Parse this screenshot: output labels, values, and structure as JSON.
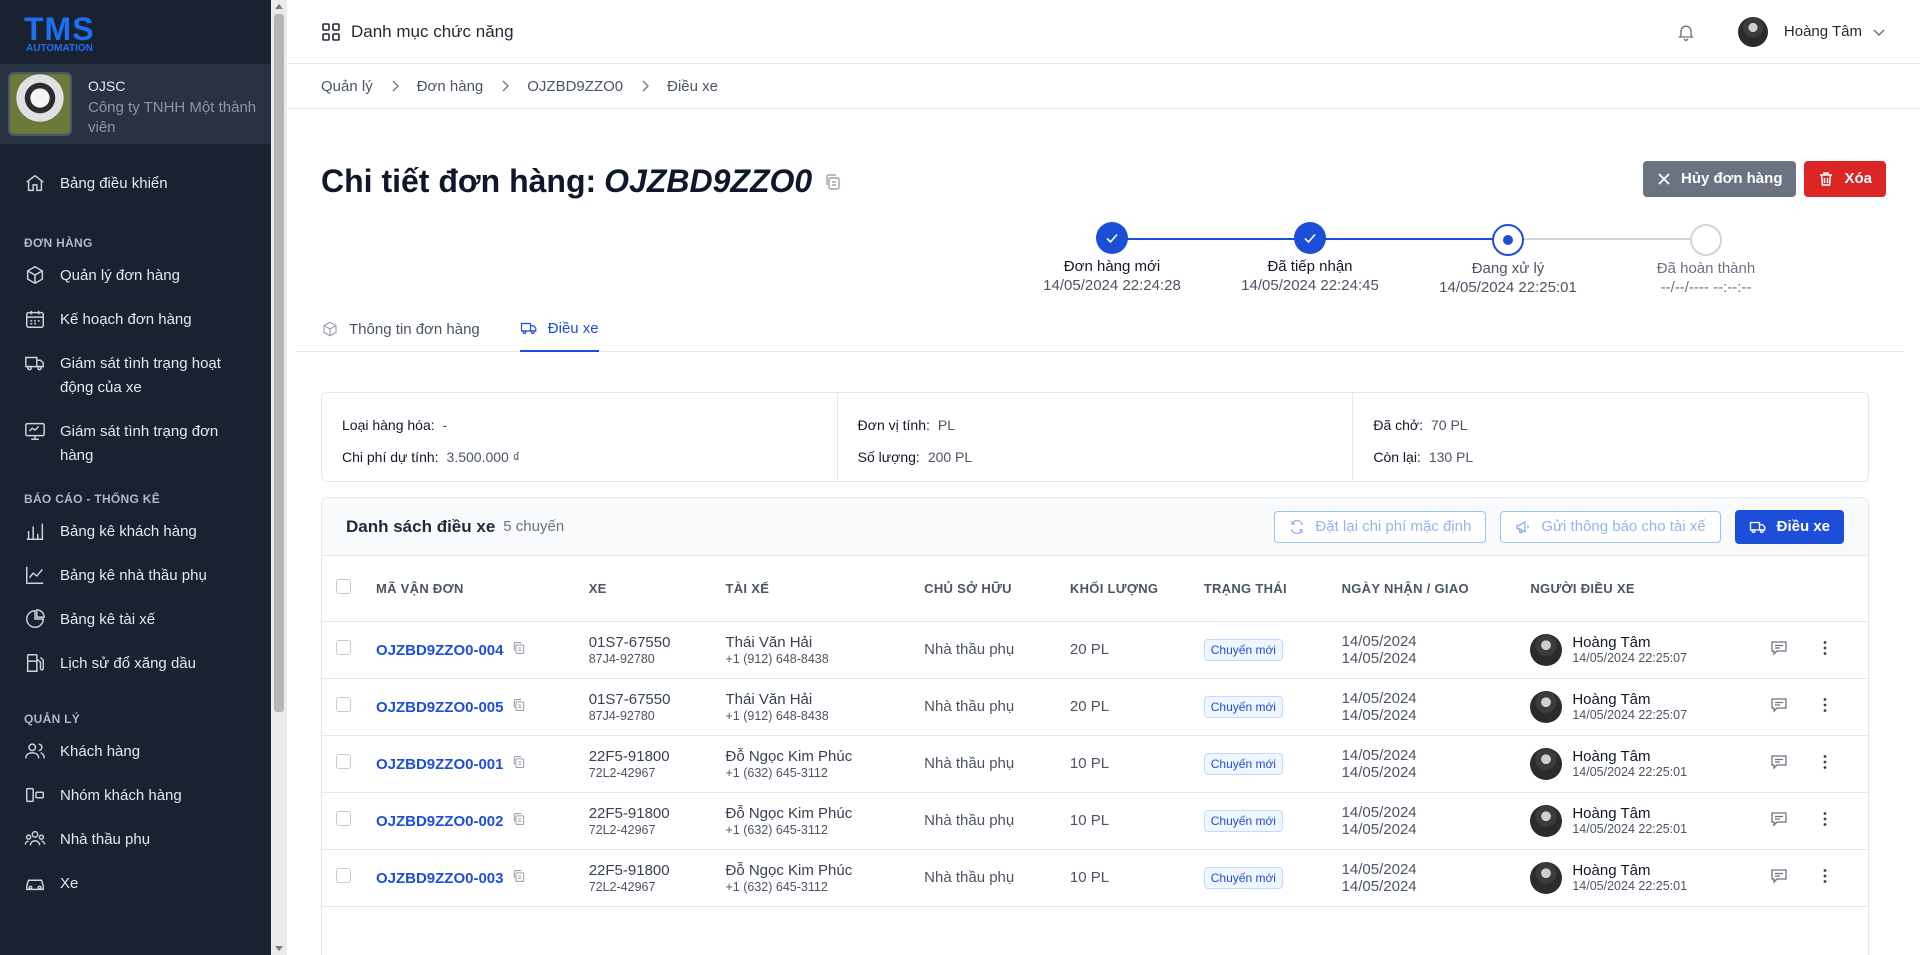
{
  "brand": {
    "logo_main": "TMS",
    "logo_sub": "AUTOMATION",
    "accent": "#1d6ff2"
  },
  "org": {
    "name": "OJSC",
    "subtitle_line1": "Công ty TNHH Một thành",
    "subtitle_line2": "viên"
  },
  "sidebar": {
    "dashboard": "Bảng điều khiển",
    "section_orders": "ĐƠN HÀNG",
    "orders": [
      {
        "label": "Quản lý đơn hàng",
        "icon": "box-icon"
      },
      {
        "label": "Kế hoạch đơn hàng",
        "icon": "calendar-icon"
      },
      {
        "label_line1": "Giám sát tình trạng hoạt",
        "label_line2": "động của xe",
        "icon": "truck-icon"
      },
      {
        "label_line1": "Giám sát tình trạng đơn",
        "label_line2": "hàng",
        "icon": "monitor-icon"
      }
    ],
    "section_reports": "BÁO CÁO - THỐNG KÊ",
    "reports": [
      {
        "label": "Bảng kê khách hàng",
        "icon": "bar-chart-icon"
      },
      {
        "label": "Bảng kê nhà thầu phụ",
        "icon": "line-chart-icon"
      },
      {
        "label": "Bảng kê tài xế",
        "icon": "pie-chart-icon"
      },
      {
        "label": "Lịch sử đổ xăng dầu",
        "icon": "fuel-icon"
      }
    ],
    "section_manage": "QUẢN LÝ",
    "manage": [
      {
        "label": "Khách hàng",
        "icon": "users-icon"
      },
      {
        "label": "Nhóm khách hàng",
        "icon": "group-icon"
      },
      {
        "label": "Nhà thầu phụ",
        "icon": "partners-icon"
      },
      {
        "label": "Xe",
        "icon": "car-icon"
      }
    ]
  },
  "topbar": {
    "menu_label": "Danh mục chức năng",
    "user_name": "Hoàng Tâm"
  },
  "breadcrumb": [
    "Quản lý",
    "Đơn hàng",
    "OJZBD9ZZO0",
    "Điều xe"
  ],
  "page": {
    "title_prefix": "Chi tiết đơn hàng:",
    "order_code": "OJZBD9ZZO0",
    "cancel_label": "Hủy đơn hàng",
    "delete_label": "Xóa"
  },
  "steps": [
    {
      "name": "Đơn hàng mới",
      "time": "14/05/2024 22:24:28",
      "state": "done"
    },
    {
      "name": "Đã tiếp nhận",
      "time": "14/05/2024 22:24:45",
      "state": "done"
    },
    {
      "name": "Đang xử lý",
      "time": "14/05/2024 22:25:01",
      "state": "current"
    },
    {
      "name": "Đã hoàn thành",
      "time": "--/--/---- --:--:--",
      "state": "pending"
    }
  ],
  "tabs": [
    {
      "label": "Thông tin đơn hàng",
      "active": false
    },
    {
      "label": "Điều xe",
      "active": true
    }
  ],
  "summary": {
    "goods_type_k": "Loại hàng hóa:",
    "goods_type_v": "-",
    "cost_k": "Chi phí dự tính:",
    "cost_v": "3.500.000 ₫",
    "unit_k": "Đơn vị tính:",
    "unit_v": "PL",
    "qty_k": "Số lượng:",
    "qty_v": "200 PL",
    "carried_k": "Đã chở:",
    "carried_v": "70 PL",
    "remaining_k": "Còn lại:",
    "remaining_v": "130 PL"
  },
  "trips": {
    "title": "Danh sách điều xe",
    "count": "5 chuyến",
    "reset_cost_label": "Đặt lại chi phí mặc định",
    "notify_label": "Gửi thông báo cho tài xế",
    "dispatch_label": "Điều xe",
    "columns": [
      "MÃ VẬN ĐƠN",
      "XE",
      "TÀI XẾ",
      "CHỦ SỞ HỮU",
      "KHỐI LƯỢNG",
      "TRẠNG THÁI",
      "NGÀY NHẬN / GIAO",
      "NGƯỜI ĐIỀU XE"
    ],
    "rows": [
      {
        "code": "OJZBD9ZZO0-004",
        "plate": "01S7-67550",
        "trailer": "87J4-92780",
        "driver": "Thái Văn Hải",
        "phone": "+1 (912) 648-8438",
        "owner": "Nhà thầu phụ",
        "weight": "20 PL",
        "status": "Chuyến mới",
        "pickup": "14/05/2024",
        "delivery": "14/05/2024",
        "dispatcher": "Hoàng Tâm",
        "dispatched_at": "14/05/2024 22:25:07"
      },
      {
        "code": "OJZBD9ZZO0-005",
        "plate": "01S7-67550",
        "trailer": "87J4-92780",
        "driver": "Thái Văn Hải",
        "phone": "+1 (912) 648-8438",
        "owner": "Nhà thầu phụ",
        "weight": "20 PL",
        "status": "Chuyến mới",
        "pickup": "14/05/2024",
        "delivery": "14/05/2024",
        "dispatcher": "Hoàng Tâm",
        "dispatched_at": "14/05/2024 22:25:07"
      },
      {
        "code": "OJZBD9ZZO0-001",
        "plate": "22F5-91800",
        "trailer": "72L2-42967",
        "driver": "Đỗ Ngọc Kim Phúc",
        "phone": "+1 (632) 645-3112",
        "owner": "Nhà thầu phụ",
        "weight": "10 PL",
        "status": "Chuyến mới",
        "pickup": "14/05/2024",
        "delivery": "14/05/2024",
        "dispatcher": "Hoàng Tâm",
        "dispatched_at": "14/05/2024 22:25:01"
      },
      {
        "code": "OJZBD9ZZO0-002",
        "plate": "22F5-91800",
        "trailer": "72L2-42967",
        "driver": "Đỗ Ngọc Kim Phúc",
        "phone": "+1 (632) 645-3112",
        "owner": "Nhà thầu phụ",
        "weight": "10 PL",
        "status": "Chuyến mới",
        "pickup": "14/05/2024",
        "delivery": "14/05/2024",
        "dispatcher": "Hoàng Tâm",
        "dispatched_at": "14/05/2024 22:25:01"
      },
      {
        "code": "OJZBD9ZZO0-003",
        "plate": "22F5-91800",
        "trailer": "72L2-42967",
        "driver": "Đỗ Ngọc Kim Phúc",
        "phone": "+1 (632) 645-3112",
        "owner": "Nhà thầu phụ",
        "weight": "10 PL",
        "status": "Chuyến mới",
        "pickup": "14/05/2024",
        "delivery": "14/05/2024",
        "dispatcher": "Hoàng Tâm",
        "dispatched_at": "14/05/2024 22:25:01"
      }
    ]
  }
}
